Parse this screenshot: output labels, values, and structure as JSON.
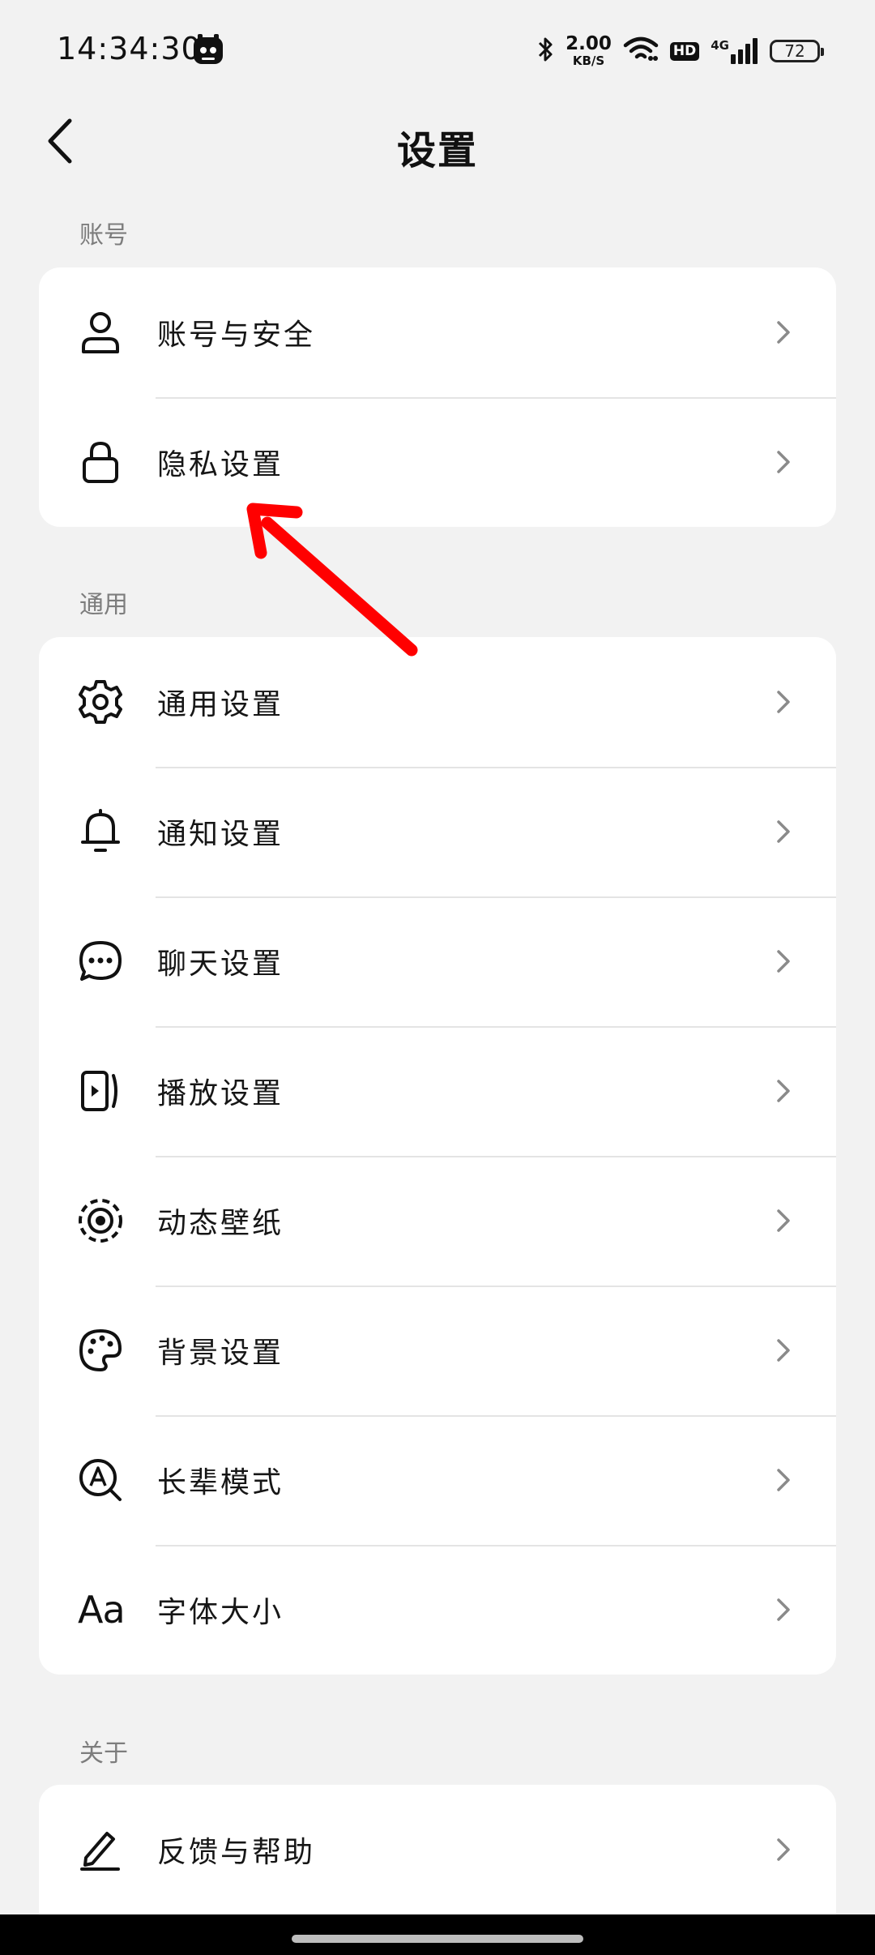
{
  "status_bar": {
    "time": "14:34:30",
    "net_speed_value": "2.00",
    "net_speed_unit": "KB/S",
    "hd_label": "HD",
    "network_type": "4G",
    "battery_level": "72",
    "icons": [
      "app-notification-icon",
      "bluetooth-icon",
      "wifi-icon",
      "signal-icon",
      "battery-icon"
    ]
  },
  "header": {
    "title": "设置"
  },
  "sections": [
    {
      "title": "账号",
      "items": [
        {
          "label": "账号与安全",
          "icon": "user-icon"
        },
        {
          "label": "隐私设置",
          "icon": "lock-icon"
        }
      ]
    },
    {
      "title": "通用",
      "items": [
        {
          "label": "通用设置",
          "icon": "gear-icon"
        },
        {
          "label": "通知设置",
          "icon": "bell-icon"
        },
        {
          "label": "聊天设置",
          "icon": "chat-bubble-icon"
        },
        {
          "label": "播放设置",
          "icon": "play-icon"
        },
        {
          "label": "动态壁纸",
          "icon": "wallpaper-icon"
        },
        {
          "label": "背景设置",
          "icon": "palette-icon"
        },
        {
          "label": "长辈模式",
          "icon": "elder-mode-icon"
        },
        {
          "label": "字体大小",
          "icon": "font-size-icon",
          "icon_text": "Aa"
        }
      ]
    },
    {
      "title": "关于",
      "items": [
        {
          "label": "反馈与帮助",
          "icon": "edit-icon"
        }
      ]
    }
  ],
  "annotation": {
    "type": "arrow",
    "color": "#ff0000",
    "points_to": "隐私设置"
  },
  "colors": {
    "background": "#f2f2f2",
    "card": "#ffffff",
    "section_label": "#7d7d7d",
    "text": "#161616",
    "divider": "#e4e4e4",
    "chevron": "#8a8a8a",
    "annotation": "#ff0000"
  }
}
